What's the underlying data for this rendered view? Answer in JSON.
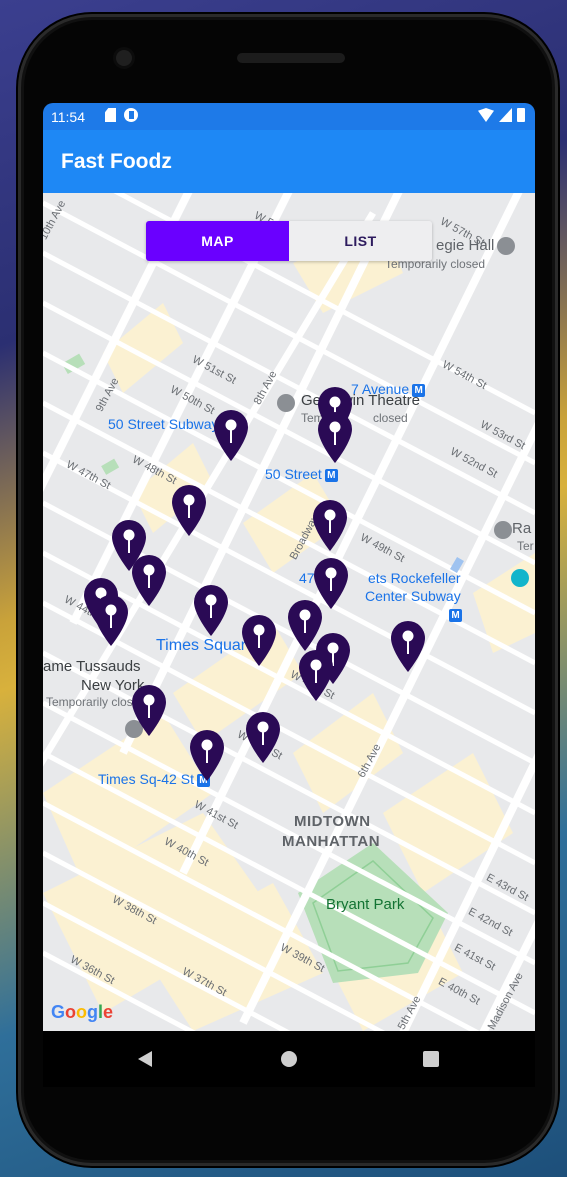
{
  "status": {
    "time": "11:54"
  },
  "app": {
    "title": "Fast Foodz"
  },
  "toggle": {
    "map_label": "MAP",
    "list_label": "LIST",
    "selected": "MAP",
    "active_color": "#6a00ff"
  },
  "map": {
    "labels": {
      "carnegie": "egie Hall",
      "carnegie_status": "Temporarily closed",
      "seventh_ave": "7 Avenue",
      "gershwin": "Gershwin Theatre",
      "gershwin_status": "Tempo",
      "gershwin_status2": "closed",
      "fifty_st_subway": "50 Street Subway",
      "fifty_st": "50 Street",
      "rockefeller1": "47-50",
      "rockefeller2": "ets Rockefeller",
      "rockefeller3": "Center Subway",
      "times_square": "Times Square",
      "tussauds": "ame Tussauds",
      "tussauds2": "New York",
      "tussauds_status": "Temporarily closed",
      "times_sq_42": "Times Sq-42 St",
      "midtown": "MIDTOWN",
      "manhattan": "MANHATTAN",
      "bryant_park": "Bryant Park",
      "ra": "Ra",
      "ter": "Ter",
      "subway_letter": "M"
    },
    "streets": {
      "tenth_ave": "10th Ave",
      "w56": "W 56th St",
      "w57": "W 57th St",
      "w54": "W 54th St",
      "w53": "W 53rd St",
      "w52": "W 52nd St",
      "w51": "W 51st St",
      "w50": "W 50th St",
      "w49": "W 49th St",
      "w48": "W 48th St",
      "w47": "W 47th St",
      "w45": "W 45th St",
      "w44": "W 44th St",
      "w43": "W 43rd St",
      "w41": "W 41st St",
      "w40": "W 40th St",
      "w39": "W 39th St",
      "w38": "W 38th St",
      "w37": "W 37th St",
      "w36": "W 36th St",
      "e43": "E 43rd St",
      "e42": "E 42nd St",
      "e41": "E 41st St",
      "e40": "E 40th St",
      "ninth_ave": "9th Ave",
      "eighth_ave": "8th Ave",
      "broadway": "Broadway",
      "sixth_ave": "6th Ave",
      "fifth_ave": "5th Ave",
      "madison_ave": "Madison Ave"
    },
    "pin_color": "#2a0a55",
    "pin_count": 23,
    "attribution": "Google"
  }
}
